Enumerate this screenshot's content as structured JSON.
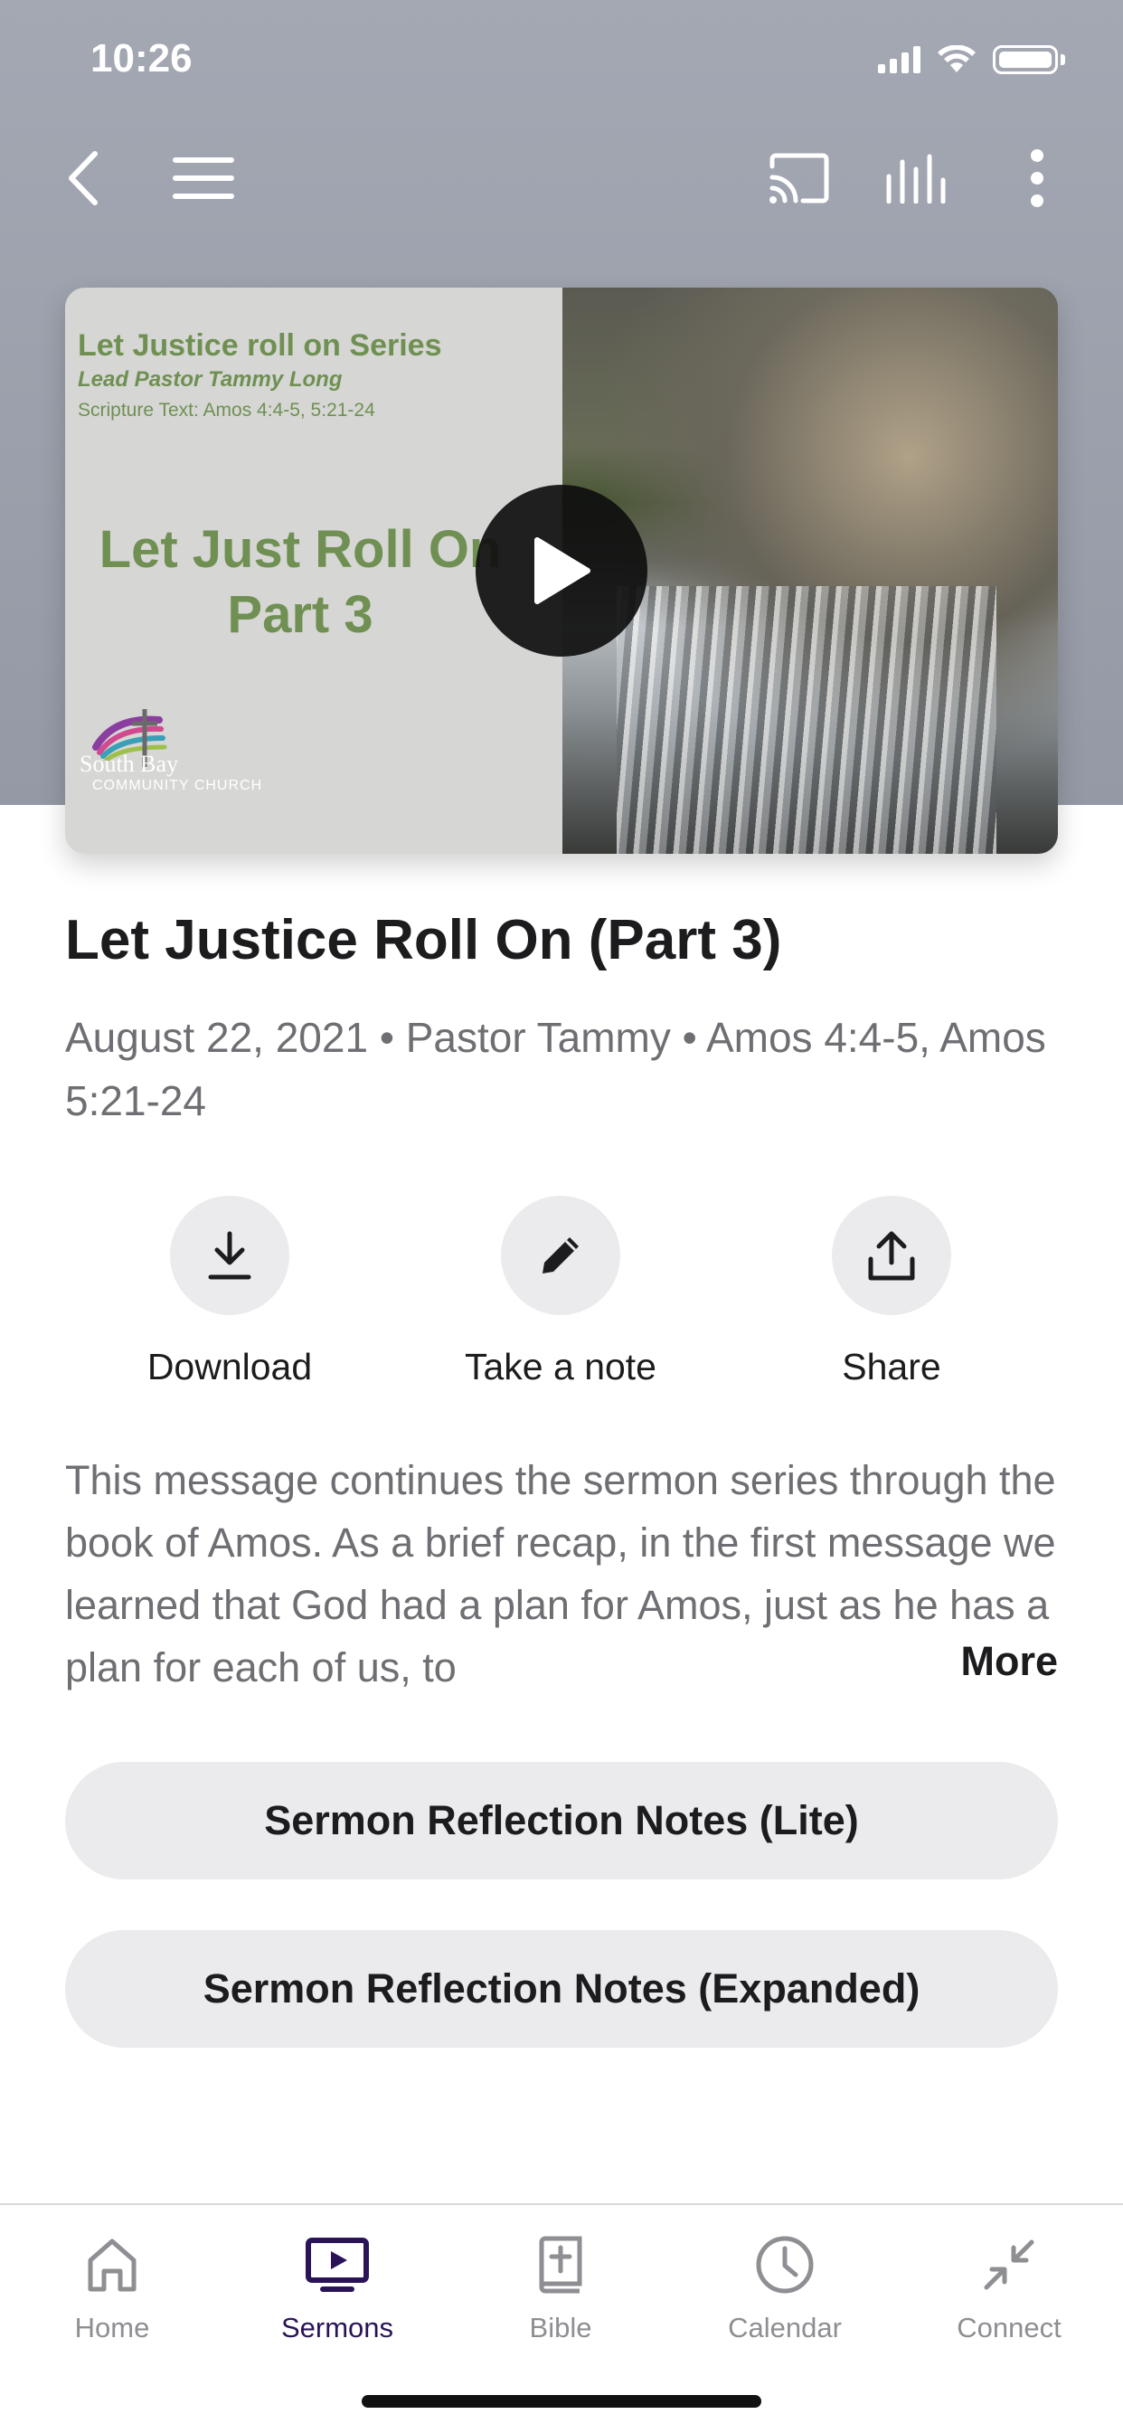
{
  "status_bar": {
    "time": "10:26"
  },
  "toolbar": {
    "icons": [
      "back-icon",
      "menu-icon",
      "cast-icon",
      "audio-levels-icon",
      "more-vertical-icon"
    ]
  },
  "video": {
    "thumbnail": {
      "series": "Let Justice roll on Series",
      "pastor": "Lead Pastor Tammy Long",
      "scripture": "Scripture Text: Amos 4:4-5, 5:21-24",
      "title_line1": "Let Just Roll On",
      "title_line2": "Part 3",
      "logo_name": "South Bay",
      "logo_sub": "COMMUNITY CHURCH"
    }
  },
  "sermon": {
    "title": "Let Justice Roll On (Part 3)",
    "meta": "August 22, 2021 • Pastor Tammy  • Amos 4:4-5, Amos 5:21-24",
    "description": "This message continues the sermon series through the book of Amos. As a brief recap, in the first message we learned that God had a plan for Amos, just as he has a plan for each of us, to",
    "more_label": "More"
  },
  "actions": [
    {
      "label": "Download",
      "icon": "download-icon"
    },
    {
      "label": "Take a note",
      "icon": "pencil-icon"
    },
    {
      "label": "Share",
      "icon": "share-icon"
    }
  ],
  "buttons": {
    "notes_lite": "Sermon Reflection Notes (Lite)",
    "notes_expanded": "Sermon Reflection Notes (Expanded)"
  },
  "tab_bar": {
    "active": "Sermons",
    "active_color": "#2a1457",
    "inactive_color": "#8e8e93",
    "tabs": [
      {
        "label": "Home",
        "icon": "home-icon"
      },
      {
        "label": "Sermons",
        "icon": "tv-play-icon"
      },
      {
        "label": "Bible",
        "icon": "bible-icon"
      },
      {
        "label": "Calendar",
        "icon": "clock-icon"
      },
      {
        "label": "Connect",
        "icon": "collapse-arrows-icon"
      }
    ]
  }
}
